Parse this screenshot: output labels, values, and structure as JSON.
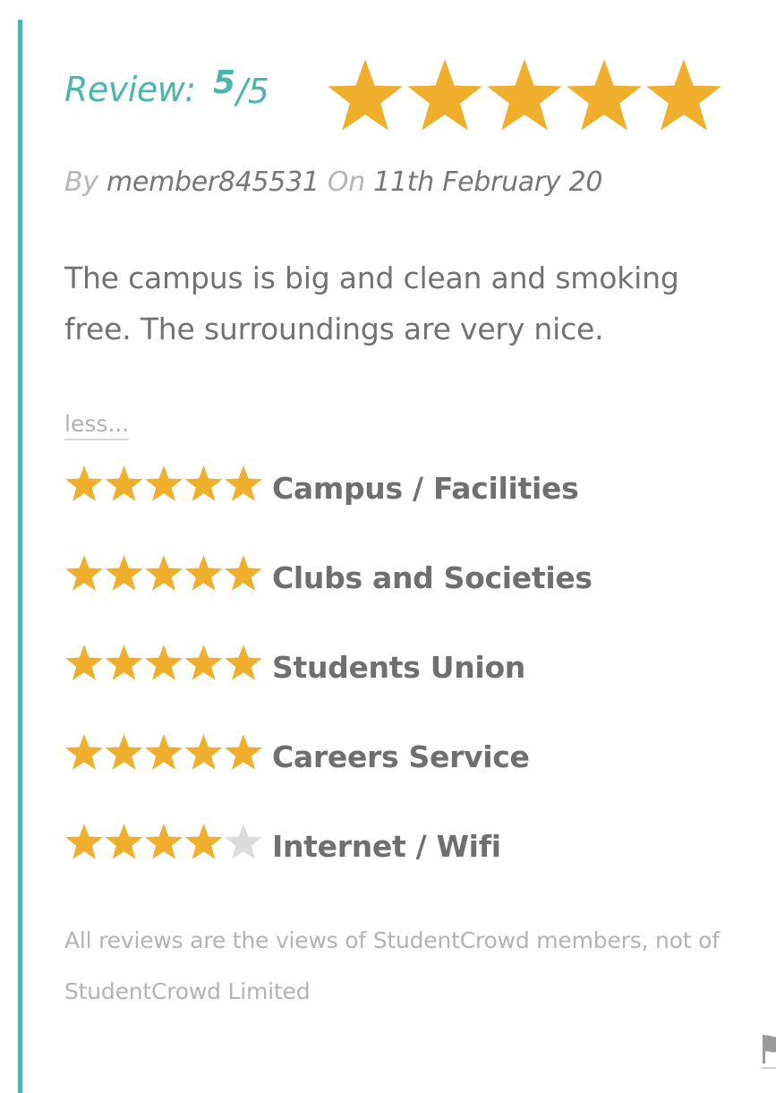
{
  "review": {
    "label": "Review:",
    "score": "5",
    "out_of": "/5",
    "overall_stars": 5,
    "max_stars": 5
  },
  "meta": {
    "by_label": "By",
    "author": "member845531",
    "on_label": "On",
    "date": "11th February 20"
  },
  "body": {
    "text": "The campus is big and clean and smoking free. The surroundings are very nice."
  },
  "less_link": {
    "label": "less..."
  },
  "ratings": [
    {
      "label": "Campus / Facilities",
      "stars": 5
    },
    {
      "label": "Clubs and Societies",
      "stars": 5
    },
    {
      "label": "Students Union",
      "stars": 5
    },
    {
      "label": "Careers Service",
      "stars": 5
    },
    {
      "label": "Internet / Wifi",
      "stars": 4
    }
  ],
  "disclaimer": {
    "text": "All reviews are the views of StudentCrowd members, not of StudentCrowd Limited"
  },
  "icons": {
    "star": "star-icon",
    "flag": "flag-icon"
  },
  "colors": {
    "accent": "#4db6ac",
    "star_filled": "#f0ae2d",
    "star_empty": "#dcdcdc",
    "text": "#727272",
    "muted": "#b3b3b3"
  }
}
